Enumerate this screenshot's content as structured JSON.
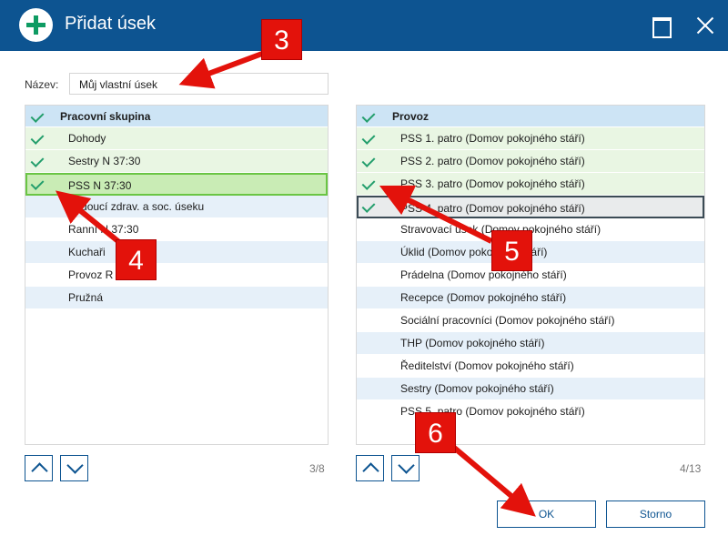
{
  "window": {
    "title": "Přidat úsek"
  },
  "name_field": {
    "label": "Název:",
    "value": "Můj vlastní úsek"
  },
  "left_list": {
    "header": "Pracovní skupina",
    "items": [
      {
        "label": "Dohody",
        "checked": true
      },
      {
        "label": "Sestry N 37:30",
        "checked": true
      },
      {
        "label": "PSS N 37:30",
        "checked": true,
        "selected": true
      },
      {
        "label": "Vedoucí zdrav. a soc. úseku",
        "checked": false
      },
      {
        "label": "Ranní N 37:30",
        "checked": false
      },
      {
        "label": "Kuchaři",
        "checked": false
      },
      {
        "label": "Provoz R 40:00",
        "checked": false
      },
      {
        "label": "Pružná",
        "checked": false
      }
    ],
    "counter": "3/8"
  },
  "right_list": {
    "header": "Provoz",
    "items": [
      {
        "label": "PSS 1. patro (Domov pokojného stáří)",
        "checked": true
      },
      {
        "label": "PSS 2. patro (Domov pokojného stáří)",
        "checked": true
      },
      {
        "label": "PSS 3. patro (Domov pokojného stáří)",
        "checked": true
      },
      {
        "label": "PSS 4. patro (Domov pokojného stáří)",
        "checked": true,
        "selected": true
      },
      {
        "label": "Stravovací úsek (Domov pokojného stáří)",
        "checked": false
      },
      {
        "label": "Úklid (Domov pokojného stáří)",
        "checked": false
      },
      {
        "label": "Prádelna (Domov pokojného stáří)",
        "checked": false
      },
      {
        "label": "Recepce (Domov pokojného stáří)",
        "checked": false
      },
      {
        "label": "Sociální pracovníci (Domov pokojného stáří)",
        "checked": false
      },
      {
        "label": "THP (Domov pokojného stáří)",
        "checked": false
      },
      {
        "label": "Ředitelství (Domov pokojného stáří)",
        "checked": false
      },
      {
        "label": "Sestry (Domov pokojného stáří)",
        "checked": false
      },
      {
        "label": "PSS 5. patro (Domov pokojného stáří)",
        "checked": false
      }
    ],
    "counter": "4/13"
  },
  "buttons": {
    "ok": "OK",
    "cancel": "Storno"
  },
  "callouts": {
    "c3": "3",
    "c4": "4",
    "c5": "5",
    "c6": "6"
  },
  "colors": {
    "titlebar": "#0d5491",
    "accent_green": "#239e6c",
    "callout_red": "#e3120b",
    "checked_row": "#e9f6e3",
    "alt_row": "#e6f0f9",
    "header_row": "#cde4f5"
  },
  "icons": {
    "app": "plus-circle-icon",
    "maximize": "maximize-icon",
    "close": "close-icon",
    "check": "checkmark-icon",
    "up": "chevron-up-icon",
    "down": "chevron-down-icon"
  }
}
